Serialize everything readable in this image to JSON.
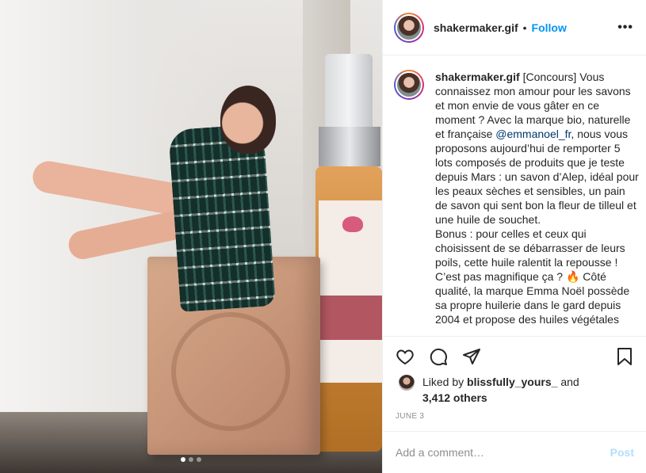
{
  "post": {
    "username": "shakermaker.gif",
    "separator": "•",
    "follow_label": "Follow",
    "more_label": "•••",
    "caption": {
      "user": "shakermaker.gif",
      "text_part1": "[Concours] Vous connaissez mon amour pour les savons et mon envie de vous gâter en ce moment ? Avec la marque bio, naturelle et française ",
      "mention": "@emmanoel_fr",
      "text_part2": ", nous vous proposons aujourd’hui de remporter 5 lots composés de produits que je teste depuis Mars : un savon d’Alep, idéal pour les peaux sèches et sensibles, un pain de savon qui sent bon la fleur de tilleul et une huile de souchet.",
      "text_part3": "Bonus : pour celles et ceux qui choisissent de se débarrasser de leurs poils, cette huile ralentit la repousse ! C’est pas magnifique ça ? 🔥 Côté qualité, la marque Emma Noël possède sa propre huilerie dans le gard depuis 2004 et propose des huiles végétales"
    },
    "likes": {
      "prefix": "Liked by ",
      "user": "blissfully_yours_",
      "and": " and",
      "others": "3,412 others"
    },
    "date": "JUNE 3",
    "comment_placeholder": "Add a comment…",
    "post_label": "Post",
    "carousel": {
      "count": 3,
      "active": 0
    }
  },
  "icons": {
    "like": "heart-icon",
    "comment": "comment-icon",
    "share": "paper-plane-icon",
    "save": "bookmark-icon",
    "more": "more-options-icon"
  },
  "colors": {
    "follow": "#0095f6",
    "post_disabled": "#b2dffc",
    "mention": "#00376b",
    "muted": "#8e8e8e"
  }
}
